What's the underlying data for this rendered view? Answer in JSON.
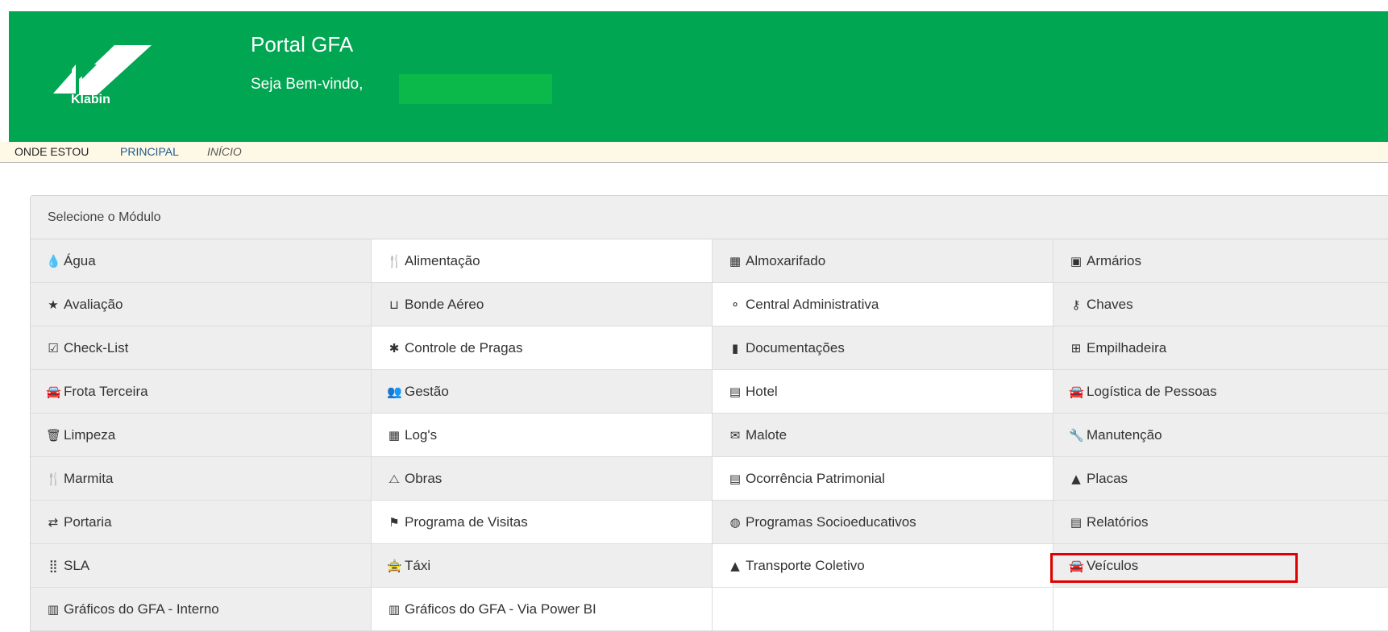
{
  "header": {
    "logo_text": "Klabin",
    "title": "Portal GFA",
    "welcome": "Seja Bem-vindo,",
    "bg_color": "#00a651"
  },
  "breadcrumb": {
    "where": "ONDE ESTOU",
    "principal": "PRINCIPAL",
    "inicio": "INÍCIO"
  },
  "panel": {
    "heading": "Selecione o Módulo",
    "rows": [
      [
        {
          "label": "Água",
          "icon": "drop-icon",
          "glyph": "💧"
        },
        {
          "label": "Alimentação",
          "icon": "cutlery-icon",
          "glyph": "🍴"
        },
        {
          "label": "Almoxarifado",
          "icon": "barcode-icon",
          "glyph": "▦"
        },
        {
          "label": "Armários",
          "icon": "locker-icon",
          "glyph": "▣"
        }
      ],
      [
        {
          "label": "Avaliação",
          "icon": "star-icon",
          "glyph": "★"
        },
        {
          "label": "Bonde Aéreo",
          "icon": "inbox-icon",
          "glyph": "⊔"
        },
        {
          "label": "Central Administrativa",
          "icon": "sitemap-icon",
          "glyph": "⚬"
        },
        {
          "label": "Chaves",
          "icon": "key-icon",
          "glyph": "⚷"
        }
      ],
      [
        {
          "label": "Check-List",
          "icon": "check-square-icon",
          "glyph": "☑"
        },
        {
          "label": "Controle de Pragas",
          "icon": "bug-icon",
          "glyph": "✱"
        },
        {
          "label": "Documentações",
          "icon": "file-icon",
          "glyph": "▮"
        },
        {
          "label": "Empilhadeira",
          "icon": "forklift-icon",
          "glyph": "⊞"
        }
      ],
      [
        {
          "label": "Frota Terceira",
          "icon": "car-icon",
          "glyph": "🚘"
        },
        {
          "label": "Gestão",
          "icon": "users-icon",
          "glyph": "👥"
        },
        {
          "label": "Hotel",
          "icon": "building-icon",
          "glyph": "▤"
        },
        {
          "label": "Logística de Pessoas",
          "icon": "car-icon",
          "glyph": "🚘"
        }
      ],
      [
        {
          "label": "Limpeza",
          "icon": "trash-icon",
          "glyph": "🗑"
        },
        {
          "label": "Log's",
          "icon": "th-icon",
          "glyph": "▦"
        },
        {
          "label": "Malote",
          "icon": "envelope-icon",
          "glyph": "✉"
        },
        {
          "label": "Manutenção",
          "icon": "wrench-icon",
          "glyph": "🔧"
        }
      ],
      [
        {
          "label": "Marmita",
          "icon": "cutlery-icon",
          "glyph": "🍴"
        },
        {
          "label": "Obras",
          "icon": "tent-icon",
          "glyph": "⧍"
        },
        {
          "label": "Ocorrência Patrimonial",
          "icon": "list-alt-icon",
          "glyph": "▤"
        },
        {
          "label": "Placas",
          "icon": "warning-icon",
          "glyph": "▲"
        }
      ],
      [
        {
          "label": "Portaria",
          "icon": "exchange-icon",
          "glyph": "⇄"
        },
        {
          "label": "Programa de Visitas",
          "icon": "flag-icon",
          "glyph": "⚑"
        },
        {
          "label": "Programas Socioeducativos",
          "icon": "globe-icon",
          "glyph": "◍"
        },
        {
          "label": "Relatórios",
          "icon": "list-alt-icon",
          "glyph": "▤"
        }
      ],
      [
        {
          "label": "SLA",
          "icon": "sla-icon",
          "glyph": "⣿"
        },
        {
          "label": "Táxi",
          "icon": "taxi-icon",
          "glyph": "🚖"
        },
        {
          "label": "Transporte Coletivo",
          "icon": "road-icon",
          "glyph": "▲"
        },
        {
          "label": "Veículos",
          "icon": "car-icon",
          "glyph": "🚘"
        }
      ],
      [
        {
          "label": "Gráficos do GFA - Interno",
          "icon": "bar-chart-icon",
          "glyph": "▥"
        },
        {
          "label": "Gráficos do GFA - Via Power BI",
          "icon": "bar-chart-icon",
          "glyph": "▥"
        },
        null,
        null
      ]
    ]
  }
}
